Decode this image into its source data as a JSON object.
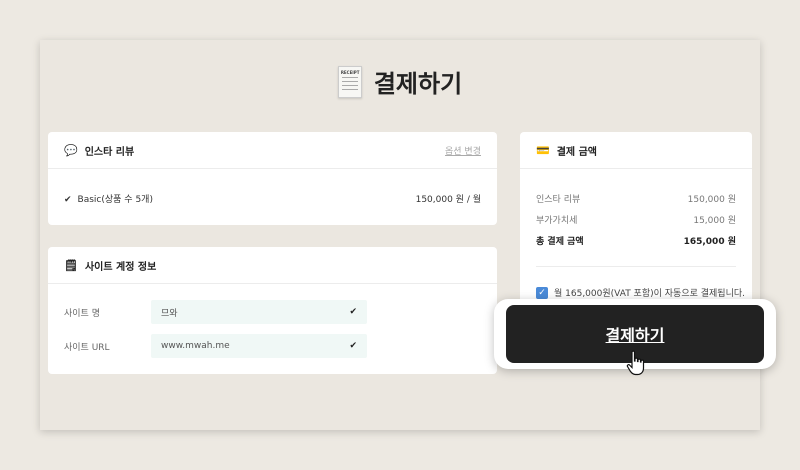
{
  "page": {
    "title": "결제하기"
  },
  "receipt_icon": {
    "label": "RECEIPT"
  },
  "review_card": {
    "icon": "speech-bubble-icon",
    "title": "인스타 리뷰",
    "change_link": "옵션 변경",
    "item_label": "Basic(상품 수 5개)",
    "item_price": "150,000 원 / 월"
  },
  "account_card": {
    "icon": "notepad-icon",
    "title": "사이트 계정 정보",
    "fields": [
      {
        "label": "사이트 명",
        "value": "므와"
      },
      {
        "label": "사이트 URL",
        "value": "www.mwah.me"
      }
    ]
  },
  "summary_card": {
    "icon": "credit-card-icon",
    "title": "결제 금액",
    "lines": [
      {
        "label": "인스타 리뷰",
        "value": "150,000 원"
      },
      {
        "label": "부가가치세",
        "value": "15,000 원"
      },
      {
        "label": "총 결제 금액",
        "value": "165,000 원"
      }
    ],
    "agreement": "월 165,000원(VAT 포함)이 자동으로 결제됩니다.",
    "agreement_checked": true
  },
  "pay_button": {
    "label": "결제하기"
  },
  "colors": {
    "button": "#222222",
    "checkbox": "#4a8ad8",
    "field_bg": "#f0f8f6"
  }
}
